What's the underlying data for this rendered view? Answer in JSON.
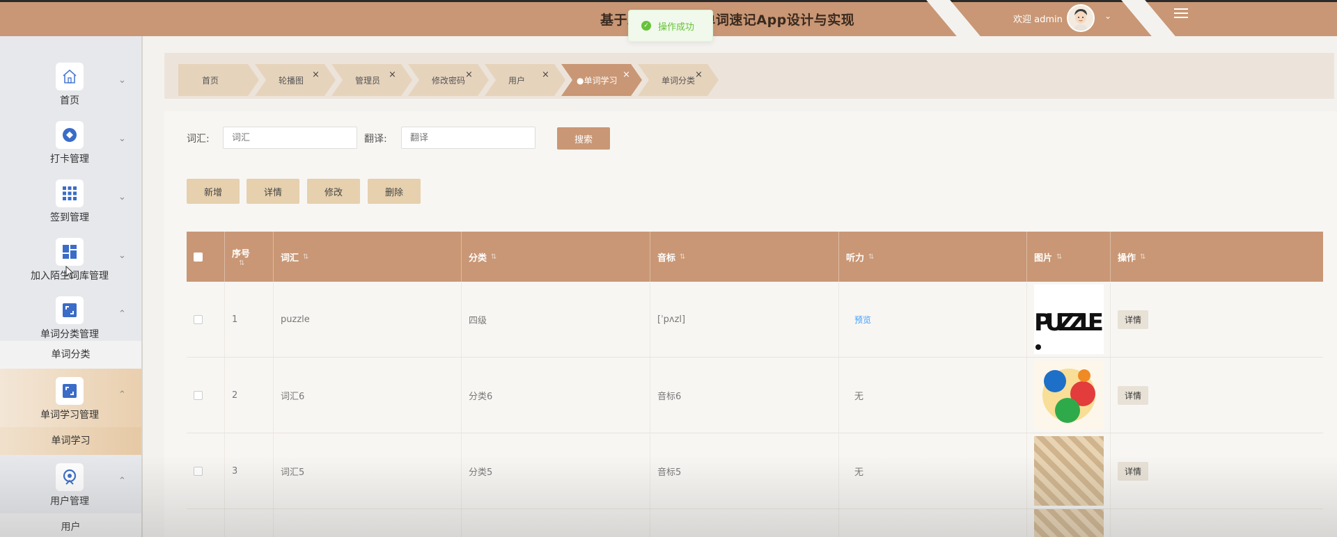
{
  "header": {
    "title": "基于Android的单词速记App设计与实现",
    "welcome": "欢迎 admin",
    "colors": {
      "primary": "#c99775",
      "accent": "#e6d0ad",
      "success": "#67c23a"
    }
  },
  "toast": {
    "text": "操作成功"
  },
  "sidebar": {
    "items": [
      {
        "label": "首页",
        "icon": "home-icon"
      },
      {
        "label": "打卡管理",
        "icon": "target-icon"
      },
      {
        "label": "签到管理",
        "icon": "grid-icon"
      },
      {
        "label": "加入陌生词库管理",
        "icon": "dashboard-icon"
      },
      {
        "label": "单词分类管理",
        "icon": "frame-icon",
        "submenu": "单词分类"
      },
      {
        "label": "单词学习管理",
        "icon": "frame-icon",
        "submenu": "单词学习"
      },
      {
        "label": "用户管理",
        "icon": "user-badge-icon",
        "submenu": "用户"
      }
    ]
  },
  "tabs": [
    {
      "label": "首页"
    },
    {
      "label": "轮播图"
    },
    {
      "label": "管理员"
    },
    {
      "label": "修改密码"
    },
    {
      "label": "用户"
    },
    {
      "label": "●单词学习"
    },
    {
      "label": "单词分类"
    }
  ],
  "search": {
    "word_label": "词汇:",
    "word_placeholder": "词汇",
    "translate_label": "翻译:",
    "translate_placeholder": "翻译",
    "button": "搜索"
  },
  "actions": {
    "add": "新增",
    "detail": "详情",
    "edit": "修改",
    "delete": "删除"
  },
  "table": {
    "headers": {
      "index": "序号",
      "word": "词汇",
      "category": "分类",
      "phonetic": "音标",
      "listening": "听力",
      "picture": "图片",
      "operation": "操作"
    },
    "rows": [
      {
        "index": "1",
        "word": "puzzle",
        "category": "四级",
        "phonetic": "[ˈpʌzl]",
        "listening": "预览",
        "detail": "详情"
      },
      {
        "index": "2",
        "word": "词汇6",
        "category": "分类6",
        "phonetic": "音标6",
        "listening": "无",
        "detail": "详情"
      },
      {
        "index": "3",
        "word": "词汇5",
        "category": "分类5",
        "phonetic": "音标5",
        "listening": "无",
        "detail": "详情"
      }
    ]
  }
}
